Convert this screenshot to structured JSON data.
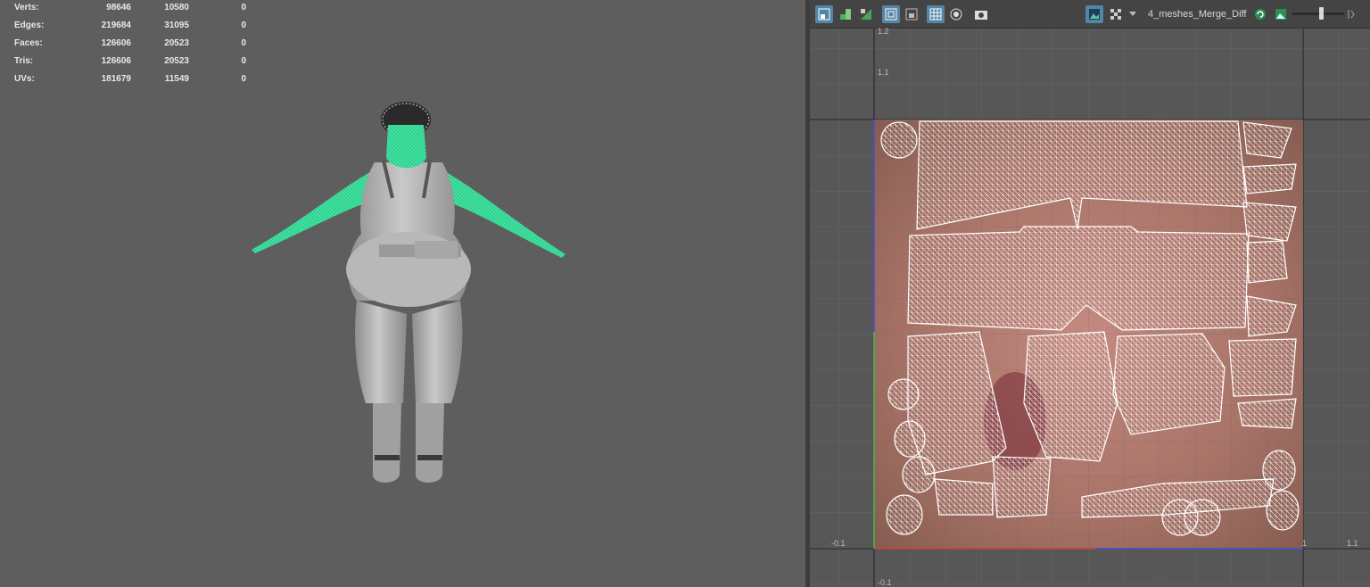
{
  "stats": {
    "rows": [
      {
        "label": "Verts:",
        "values": [
          "98646",
          "10580",
          "0"
        ]
      },
      {
        "label": "Edges:",
        "values": [
          "219684",
          "31095",
          "0"
        ]
      },
      {
        "label": "Faces:",
        "values": [
          "126606",
          "20523",
          "0"
        ]
      },
      {
        "label": "Tris:",
        "values": [
          "126606",
          "20523",
          "0"
        ]
      },
      {
        "label": "UVs:",
        "values": [
          "181679",
          "11549",
          "0"
        ]
      }
    ]
  },
  "uv_editor": {
    "texture_name": "4_meshes_Merge_Diff",
    "axis_labels": {
      "top_12": "1.2",
      "top_11": "1.1",
      "bottom_left": "-0.1",
      "bottom_mid": "1",
      "bottom_right": "1.1",
      "bottom_edge": "-0.1"
    },
    "exposure": 0.6
  },
  "colors": {
    "selection_green": "#45e6a0",
    "active_button": "#5285a6",
    "viewport_bg": "#5e5e5e",
    "uv_bg": "#575757"
  }
}
